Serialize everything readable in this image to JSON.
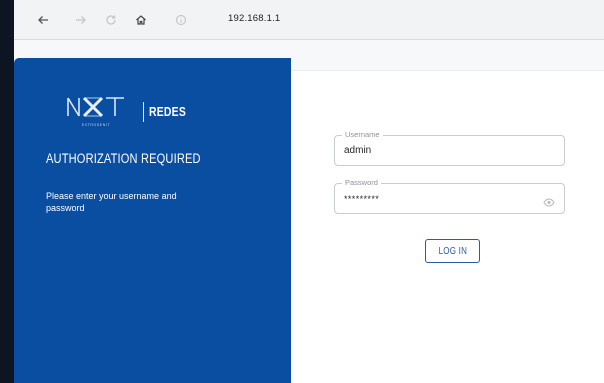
{
  "browser": {
    "url": "192.168.1.1",
    "icons": [
      "back-arrow-icon",
      "forward-arrow-icon",
      "reload-icon",
      "home-icon",
      "site-info-icon"
    ]
  },
  "brand": {
    "logo_name": "NXT",
    "logo_tagline": "EXTROSENIT",
    "product": "REDES"
  },
  "panel": {
    "title": "AUTHORIZATION REQUIRED",
    "description": "Please enter your username and password",
    "color": "#0a4ea2"
  },
  "form": {
    "username": {
      "label": "Username",
      "value": "admin"
    },
    "password": {
      "label": "Password",
      "value": "*********"
    },
    "login_label": "LOG IN"
  },
  "colors": {
    "accent": "#2a5ba5",
    "background": "#0d1522"
  }
}
